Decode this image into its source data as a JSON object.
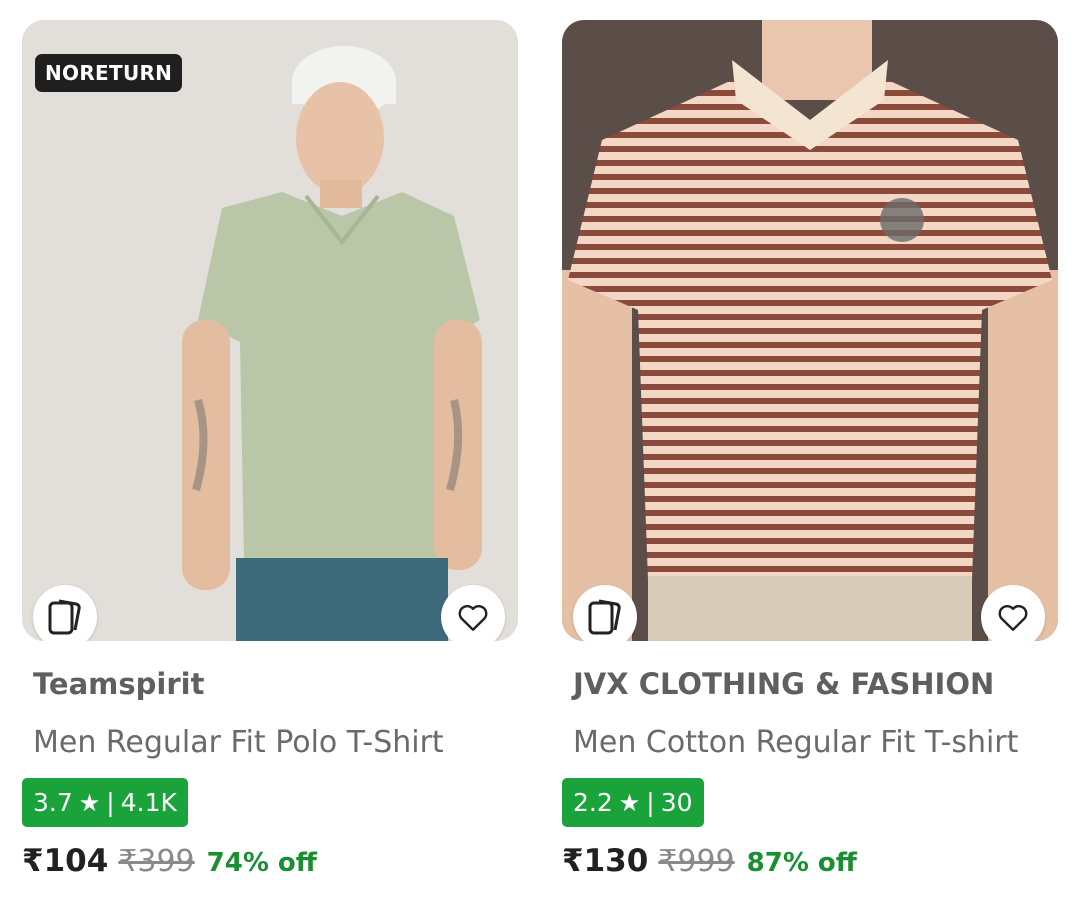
{
  "products": [
    {
      "tag": "NORETURN",
      "brand": "Teamspirit",
      "title": "Men Regular Fit Polo T-Shirt",
      "rating": "3.7",
      "rating_count": "4.1K",
      "price": "₹104",
      "mrp": "₹399",
      "discount": "74% off",
      "image_subject": "man in sage green polo t-shirt and white cap"
    },
    {
      "brand": "JVX CLOTHING & FASHION",
      "title": "Men Cotton Regular Fit T-shirt",
      "rating": "2.2",
      "rating_count": "30",
      "price": "₹130",
      "mrp": "₹999",
      "discount": "87% off",
      "image_subject": "man in brown and cream striped polo t-shirt"
    }
  ],
  "icons": {
    "compare": "cards-stack-icon",
    "wishlist": "heart-outline-icon",
    "rating": "star-icon"
  },
  "colors": {
    "rating_bg": "#1aa33b",
    "discount": "#1a8f31",
    "tag_bg": "#1f1f1f"
  },
  "separator": "|",
  "star": "★"
}
